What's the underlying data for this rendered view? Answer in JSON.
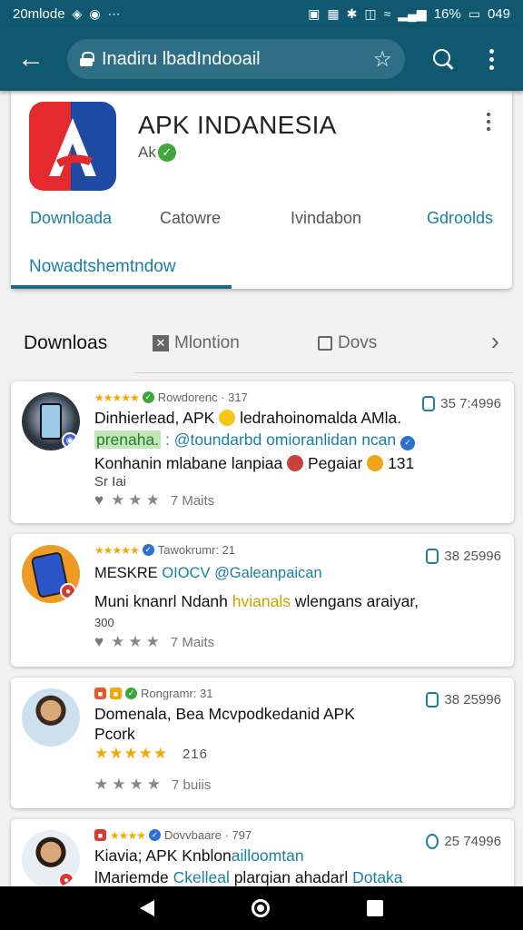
{
  "status_bar": {
    "left_text": "20mlode",
    "battery": "16%",
    "time": "049"
  },
  "app_bar": {
    "url": "Inadiru lbadIndooail"
  },
  "header": {
    "app_name": "APK INDANESIA",
    "subtitle": "Ak",
    "tabs": [
      "Downloada",
      "Catowre",
      "Ivindabon",
      "Gdroolds"
    ],
    "now_label": "Nowadtshemtndow"
  },
  "filter": {
    "title": "Downloas",
    "chips": [
      "Mlontion",
      "Dovs"
    ]
  },
  "cards": [
    {
      "meta": "Rowdorenc · 317",
      "count": "35 7:4996",
      "line1": "Dinhierlead, APK",
      "line1b": "ledrahoinomalda AMla.",
      "line2a": "prenaha.",
      "line2b": ": @toundarbd omioranlidan ncan",
      "line3a": "Konhanin mlabane lanpiaa",
      "line3b": "Pegaiar",
      "line3c": "131",
      "line4": "Sr Iai",
      "likes": "7 Maits"
    },
    {
      "meta": "Tawokrumr: 21",
      "count": "38 25996",
      "line1a": "MESKRE",
      "line1b": "OIOCV",
      "line1c": "@Galeanpaican",
      "line2a": "Muni knanrl Ndanh",
      "line2b": "hvianals",
      "line2c": "wlengans araiyar,",
      "line3": "300",
      "likes": "7 Maits"
    },
    {
      "meta": "Rongramr: 31",
      "count": "38 25996",
      "line1": "Domenala, Bea Mcvpodkedanid APK",
      "line2": "Pcork",
      "rating_count": "216",
      "likes": "7 buiis"
    },
    {
      "meta": "Dovvbaare · 797",
      "count": "25 74996",
      "line1a": "Kiavia; APK Knblon",
      "line1b": "ailloomtan",
      "line2a": "lMariemde",
      "line2b": "Ckelleal",
      "line2c": "plarqian ahadarl",
      "line2d": "Dotaka"
    }
  ]
}
